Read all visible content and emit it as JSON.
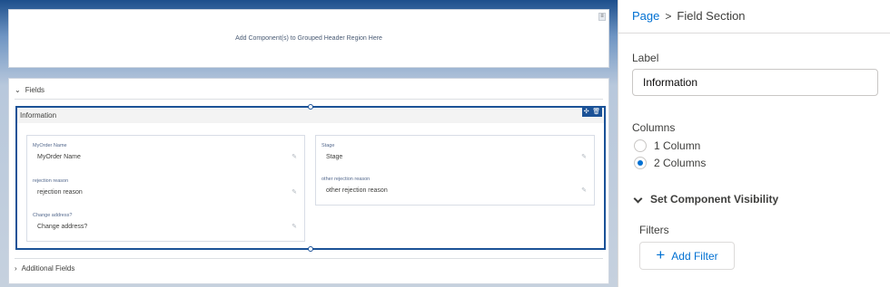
{
  "canvas": {
    "header_region_text": "Add Component(s) to Grouped Header Region Here",
    "header_menu_icon": "≡",
    "fields_section_label": "Fields",
    "section": {
      "title": "Information",
      "left_fields": [
        {
          "label": "MyOrder Name",
          "value": "MyOrder Name"
        },
        {
          "label": "rejection reason",
          "value": "rejection reason"
        },
        {
          "label": "Change address?",
          "value": "Change address?"
        }
      ],
      "right_fields": [
        {
          "label": "Stage",
          "value": "Stage"
        },
        {
          "label": "other rejection reason",
          "value": "other rejection reason"
        }
      ]
    },
    "additional_fields_label": "Additional Fields"
  },
  "panel": {
    "breadcrumb": {
      "root": "Page",
      "separator": ">",
      "current": "Field Section"
    },
    "label_title": "Label",
    "label_value": "Information",
    "columns_title": "Columns",
    "column_options": [
      {
        "label": "1 Column",
        "selected": false
      },
      {
        "label": "2 Columns",
        "selected": true
      }
    ],
    "visibility_label": "Set Component Visibility",
    "filters_title": "Filters",
    "add_filter_label": "Add Filter"
  },
  "colors": {
    "accent": "#0070d2",
    "selection": "#1b5297",
    "text": "#3e3e3c"
  }
}
